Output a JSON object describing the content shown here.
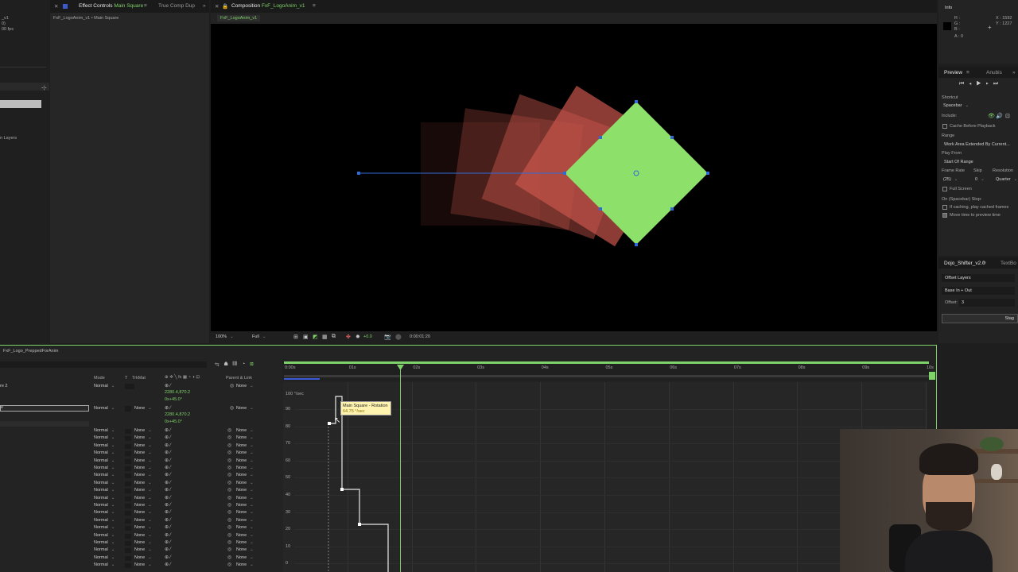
{
  "left_panel": {
    "title_lines": [
      "_v1",
      "0)",
      "00 fps"
    ],
    "layer_item": "n Layers"
  },
  "effect_controls": {
    "tab_label": "Effect Controls",
    "tab_layer": "Main Square",
    "tab_other": "True Comp Dup",
    "subtitle": "FxF_LogoAnim_v1 • Main Square"
  },
  "composition": {
    "tab_label": "Composition",
    "tab_name": "FxF_LogoAnim_v1",
    "subtab": "FxF_LogoAnim_v1"
  },
  "viewer_toolbar": {
    "zoom": "100%",
    "resolution": "Full",
    "exposure": "+0.0",
    "timecode": "0:00:01:20"
  },
  "info_panel": {
    "title": "Info",
    "channels": [
      "R :",
      "G :",
      "B :",
      "A : 0"
    ],
    "coords": [
      "X : 1592",
      "Y : 1227"
    ]
  },
  "preview_panel": {
    "tab_preview": "Preview",
    "tab_other": "Anubis",
    "shortcut_label": "Shortcut",
    "shortcut_value": "Spacebar",
    "include_label": "Include:",
    "cache_label": "Cache Before Playback",
    "range_label": "Range",
    "range_value": "Work Area Extended By Current...",
    "playfrom_label": "Play From",
    "playfrom_value": "Start Of Range",
    "framerate_label": "Frame Rate",
    "skip_label": "Skip",
    "res_label": "Resolution",
    "framerate_value": "(25)",
    "skip_value": "0",
    "res_value": "Quarter",
    "fullscreen_label": "Full Screen",
    "onstop_label": "On (Spacebar) Stop:",
    "ifcaching_label": "If caching, play cached frames",
    "movetime_label": "Move time to preview time"
  },
  "dojo_panel": {
    "tab": "Dojo_Shifter_v2.0",
    "tab_other": "TextBo",
    "offset_layers": "Offset Layers",
    "ease": "Base In + Out",
    "offset_label": "Offset:",
    "offset_value": "3",
    "stagger": "Stag"
  },
  "timeline": {
    "tab": "FxF_Logo_PreppedForAnim",
    "col_mode": "Mode",
    "col_t": "T",
    "col_trkmat": "TrkMat",
    "col_parent": "Parent & Link",
    "row1_name": "re 2",
    "row1_mode": "Normal",
    "row1_parent": "None",
    "row1_pos": "2280.4,870.2",
    "row1_rot": "0x+45.0°",
    "row2_mode": "Normal",
    "row2_trkmat": "None",
    "row2_parent": "None",
    "row2_pos": "2280.4,870.2",
    "row2_rot": "0x+45.0°",
    "layer_mode": "Normal",
    "layer_none": "None",
    "layer_count": 19,
    "ruler": [
      "0:00s",
      "01s",
      "02s",
      "03s",
      "04s",
      "05s",
      "06s",
      "07s",
      "08s",
      "09s",
      "10s"
    ],
    "y_unit": "100 °/sec",
    "y_ticks": [
      "90",
      "80",
      "70",
      "60",
      "50",
      "40",
      "30",
      "20",
      "10",
      "0"
    ],
    "tooltip_title": "Main Square - Rotation",
    "tooltip_value": "64.75 °/sec"
  },
  "colors": {
    "accent": "#7fd26a",
    "shape_green": "#8de06a",
    "shape_red": "#c8564b",
    "handle_blue": "#2f6bd8",
    "tooltip_bg": "#fff3b0"
  }
}
